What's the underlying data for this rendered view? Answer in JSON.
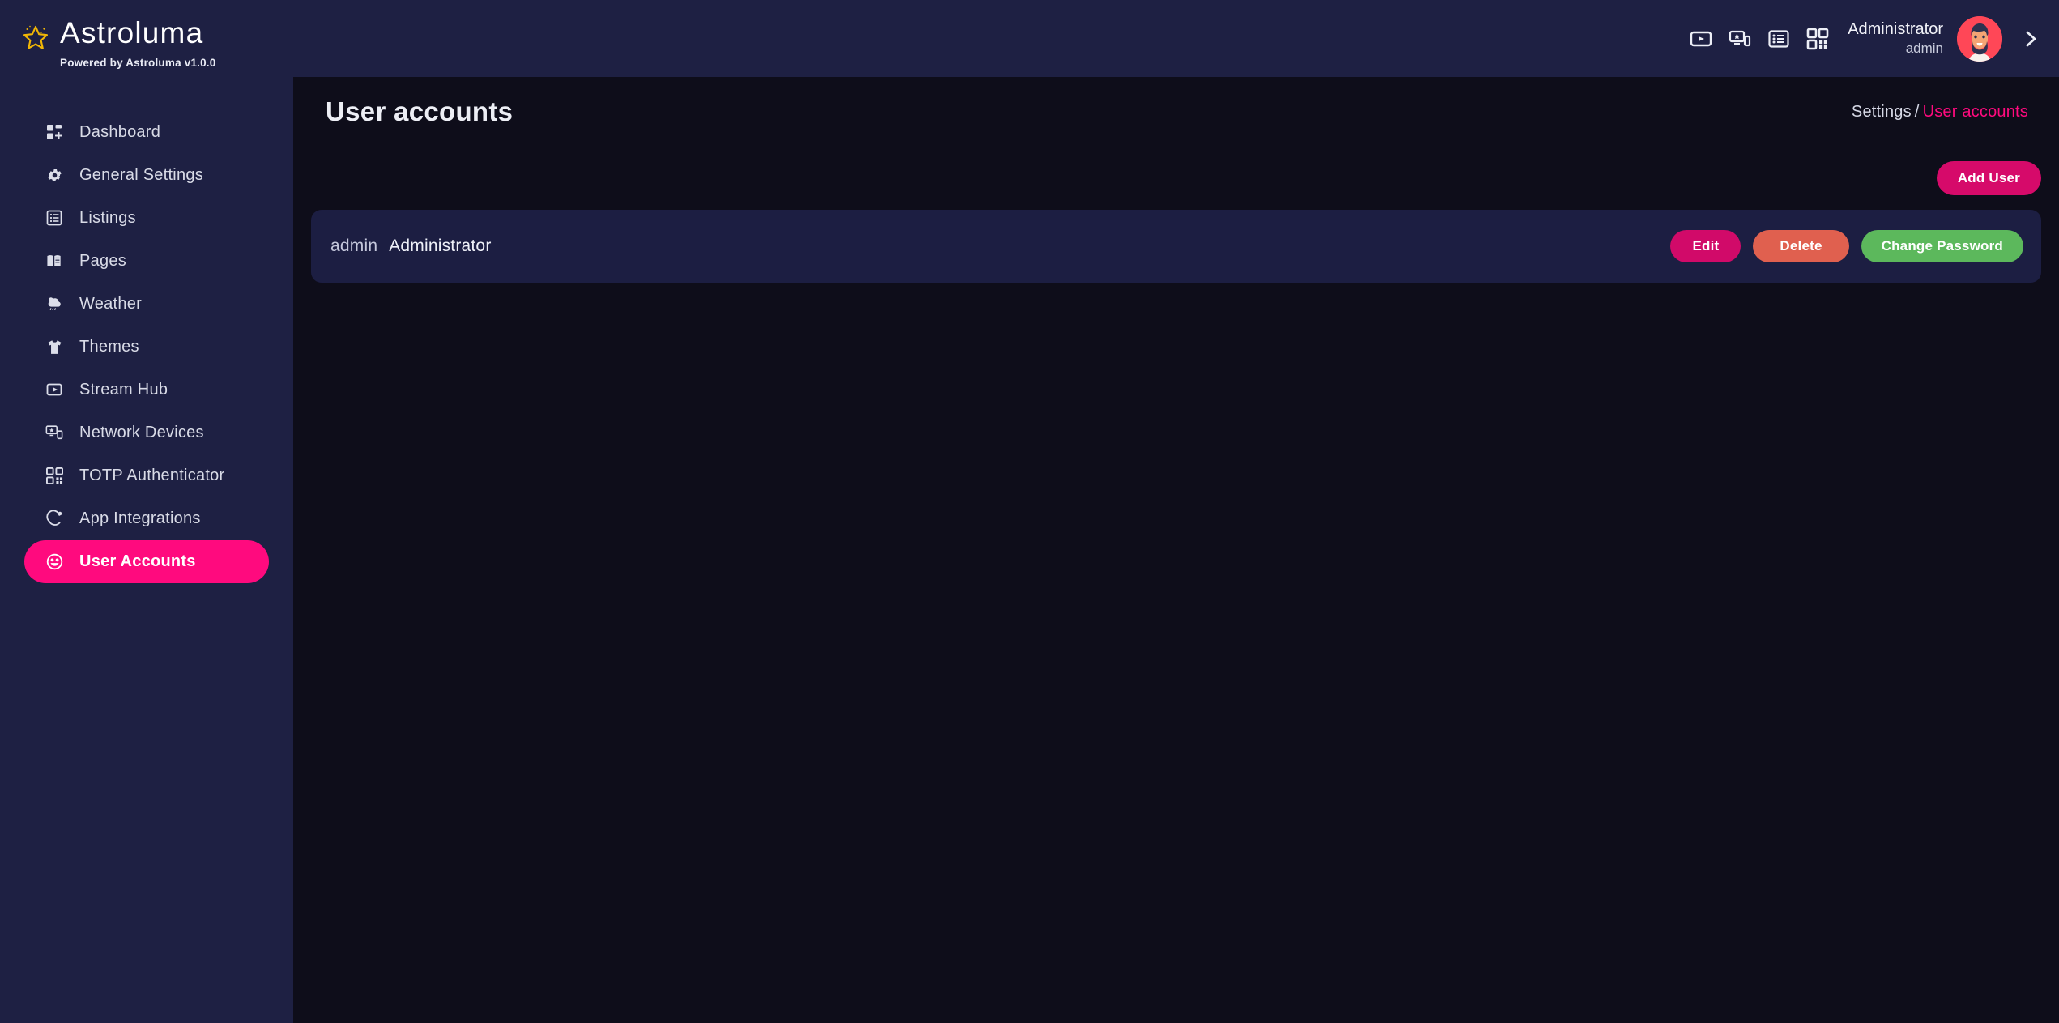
{
  "brand": {
    "name": "Astroluma",
    "tagline": "Powered by Astroluma v1.0.0",
    "logo_icon": "star-icon",
    "logo_color": "#f2b705"
  },
  "sidebar": {
    "items": [
      {
        "label": "Dashboard",
        "icon": "dashboard-grid-icon",
        "active": false
      },
      {
        "label": "General Settings",
        "icon": "gear-icon",
        "active": false
      },
      {
        "label": "Listings",
        "icon": "list-icon",
        "active": false
      },
      {
        "label": "Pages",
        "icon": "book-icon",
        "active": false
      },
      {
        "label": "Weather",
        "icon": "cloud-rain-icon",
        "active": false
      },
      {
        "label": "Themes",
        "icon": "tshirt-icon",
        "active": false
      },
      {
        "label": "Stream Hub",
        "icon": "play-square-icon",
        "active": false
      },
      {
        "label": "Network Devices",
        "icon": "monitor-devices-icon",
        "active": false
      },
      {
        "label": "TOTP Authenticator",
        "icon": "qr-code-icon",
        "active": false
      },
      {
        "label": "App Integrations",
        "icon": "refresh-dot-icon",
        "active": false
      },
      {
        "label": "User Accounts",
        "icon": "user-face-icon",
        "active": true
      }
    ],
    "active_color": "#ff0a7e",
    "background": "#1e2043"
  },
  "header": {
    "icons": [
      {
        "name": "play-video-icon"
      },
      {
        "name": "cast-device-icon"
      },
      {
        "name": "list-view-icon"
      },
      {
        "name": "qr-code-icon"
      }
    ],
    "user": {
      "name": "Administrator",
      "role": "admin",
      "avatar": "bearded-man-avatar",
      "avatar_bg": "#ff4757"
    },
    "expand_icon": "chevron-right-icon"
  },
  "main": {
    "page_title": "User accounts",
    "breadcrumb": {
      "parent": "Settings",
      "separator": "/",
      "current": "User accounts"
    },
    "toolbar": {
      "add_user_label": "Add User"
    },
    "users": [
      {
        "login": "admin",
        "role": "Administrator",
        "actions": {
          "edit": "Edit",
          "delete": "Delete",
          "change_password": "Change Password"
        }
      }
    ]
  },
  "colors": {
    "accent_pink": "#ff0a7e",
    "button_pink": "#d60a6a",
    "button_red": "#e0604f",
    "button_green": "#5cb85c",
    "panel_navy": "#1e2043",
    "card_navy": "#1c1e42",
    "page_bg": "#0e0d1a"
  }
}
